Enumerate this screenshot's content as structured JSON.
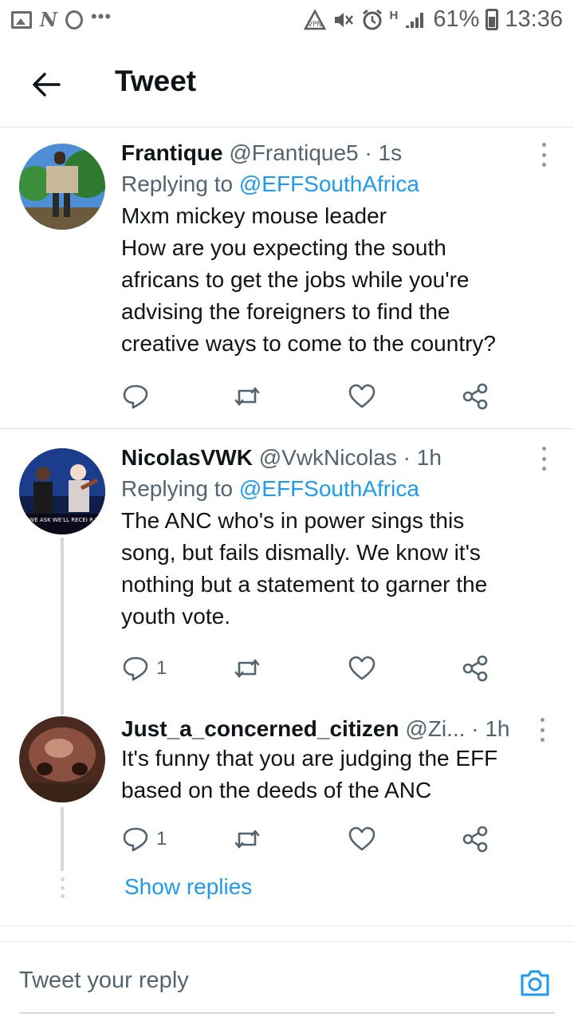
{
  "status_bar": {
    "battery": "61%",
    "time": "13:36",
    "signal_label": "H"
  },
  "header": {
    "title": "Tweet"
  },
  "tweets": [
    {
      "name": "Frantique",
      "handle": "@Frantique5",
      "time": "1s",
      "replying_prefix": "Replying to",
      "replying_to": "@EFFSouthAfrica",
      "text_lines": [
        "Mxm mickey mouse leader",
        "How are you expecting the south",
        "africans to get the jobs while you're",
        "advising the foreigners to find the",
        "creative ways to come to the country?"
      ],
      "reply_count": "",
      "avatar_icon": "avatar-photo"
    },
    {
      "name": "NicolasVWK",
      "handle": "@VwkNicolas",
      "time": "1h",
      "replying_prefix": "Replying to",
      "replying_to": "@EFFSouthAfrica",
      "text_lines": [
        "The ANC who's in power sings this",
        "song, but fails dismally. We know it's",
        "nothing but a statement to garner the",
        "youth vote."
      ],
      "reply_count": "1",
      "avatar_caption": "IF WE ASK WE'LL RECEI R THE GREATER ME"
    },
    {
      "name": "Just_a_concerned_citizen",
      "handle": "@Zi...",
      "time": "1h",
      "text_lines": [
        "It's funny that you are judging the EFF",
        "based on the deeds of the ANC"
      ],
      "reply_count": "1"
    }
  ],
  "show_replies": "Show replies",
  "reply_bar": {
    "placeholder": "Tweet your reply"
  },
  "colors": {
    "accent": "#1d9bf0",
    "text": "#0f1419",
    "muted": "#536471",
    "divider": "#e1e6ea"
  }
}
